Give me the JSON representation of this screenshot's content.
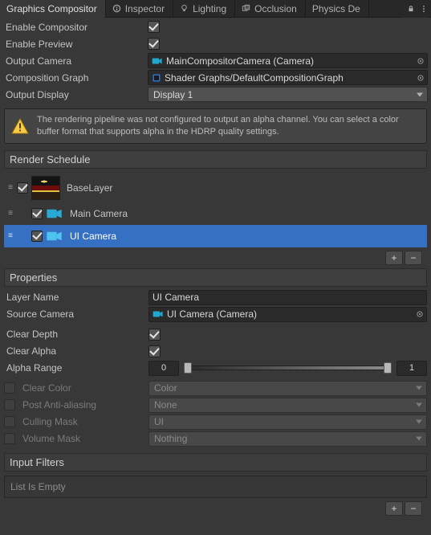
{
  "tabs": {
    "active": "Graphics Compositor",
    "items": [
      "Graphics Compositor",
      "Inspector",
      "Lighting",
      "Occlusion",
      "Physics De"
    ]
  },
  "top": {
    "enableCompositor": {
      "label": "Enable Compositor",
      "checked": true
    },
    "enablePreview": {
      "label": "Enable Preview",
      "checked": true
    },
    "outputCamera": {
      "label": "Output Camera",
      "text": "MainCompositorCamera (Camera)"
    },
    "compositionGraph": {
      "label": "Composition Graph",
      "text": "Shader Graphs/DefaultCompositionGraph"
    },
    "outputDisplay": {
      "label": "Output Display",
      "value": "Display 1"
    }
  },
  "warning": "The rendering pipeline was not configured to output an alpha channel. You can select a color buffer format that supports alpha in the HDRP quality settings.",
  "renderSchedule": {
    "title": "Render Schedule",
    "layers": [
      {
        "name": "BaseLayer",
        "checked": true,
        "kind": "image",
        "indent": 0
      },
      {
        "name": "Main Camera",
        "checked": true,
        "kind": "camera",
        "indent": 1
      },
      {
        "name": "UI Camera",
        "checked": true,
        "kind": "camera",
        "indent": 1,
        "selected": true
      }
    ]
  },
  "properties": {
    "title": "Properties",
    "layerName": {
      "label": "Layer Name",
      "value": "UI Camera"
    },
    "sourceCamera": {
      "label": "Source Camera",
      "text": "UI Camera (Camera)"
    },
    "clearDepth": {
      "label": "Clear Depth",
      "checked": true
    },
    "clearAlpha": {
      "label": "Clear Alpha",
      "checked": true
    },
    "alphaRange": {
      "label": "Alpha Range",
      "min": "0",
      "max": "1"
    },
    "clearColor": {
      "label": "Clear Color",
      "value": "Color",
      "enabled": false
    },
    "postAA": {
      "label": "Post Anti-aliasing",
      "value": "None",
      "enabled": false
    },
    "cullingMask": {
      "label": "Culling Mask",
      "value": "UI",
      "enabled": false
    },
    "volumeMask": {
      "label": "Volume Mask",
      "value": "Nothing",
      "enabled": false
    }
  },
  "inputFilters": {
    "title": "Input Filters",
    "empty": "List Is Empty"
  },
  "glyphs": {
    "plus": "+",
    "minus": "−"
  }
}
